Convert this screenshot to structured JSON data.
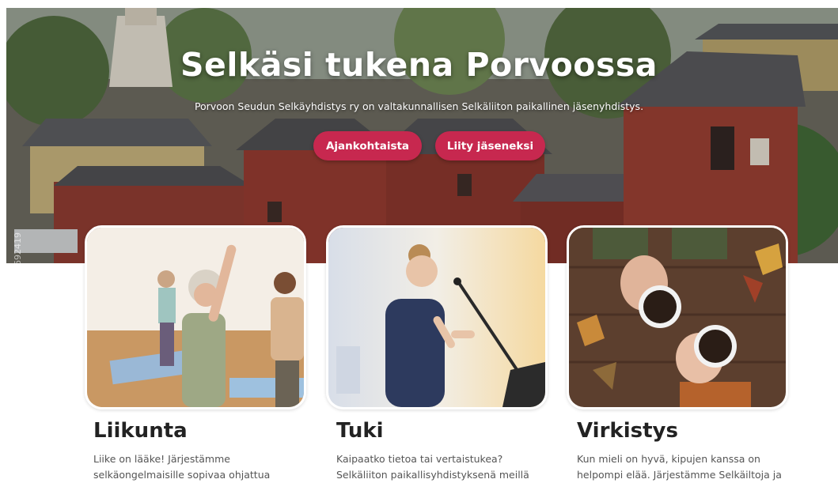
{
  "hero": {
    "title": "Selkäsi tukena Porvoossa",
    "subtitle": "Porvoon Seudun Selkäyhdistys ry on valtakunnallisen Selkäliiton paikallinen jäsenyhdistys.",
    "buttons": [
      {
        "label": "Ajankohtaista"
      },
      {
        "label": "Liity jäseneksi"
      }
    ],
    "watermark": "692419"
  },
  "cards": [
    {
      "title": "Liikunta",
      "text_lines": [
        "Liike on lääke! Järjestämme",
        "selkäongelmaisille sopivaa ohjattua"
      ],
      "image": "yoga-class-photo"
    },
    {
      "title": "Tuki",
      "text_lines": [
        "Kaipaatko tietoa tai vertaistukea?",
        "Selkäliiton paikallisyhdistyksenä meillä"
      ],
      "image": "speaker-photo"
    },
    {
      "title": "Virkistys",
      "text_lines": [
        "Kun mieli on hyvä, kipujen kanssa on",
        "helpompi elää. Järjestämme Selkäiltoja ja"
      ],
      "image": "coffee-cups-photo"
    }
  ],
  "colors": {
    "accent": "#c7284f",
    "heading": "#222222",
    "body_text": "#555555"
  }
}
